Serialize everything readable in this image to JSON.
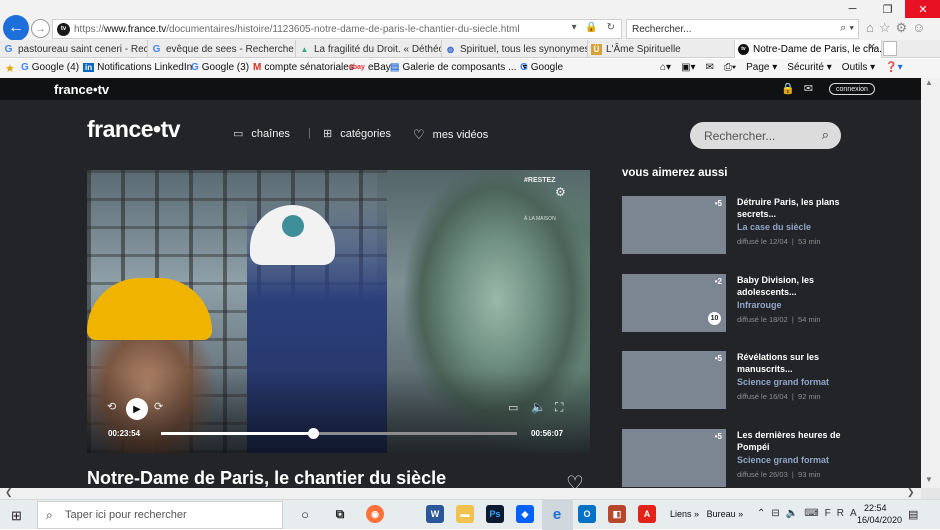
{
  "browser": {
    "url": {
      "protocol": "https://",
      "host": "www.france.tv",
      "path": "/documentaires/histoire/1123605-notre-dame-de-paris-le-chantier-du-siecle.html"
    },
    "search_placeholder": "Rechercher...",
    "tabs": [
      {
        "label": "pastoureau saint ceneri - Rech...",
        "icon": "google-icon"
      },
      {
        "label": "evêque de sees - Recherche Go...",
        "icon": "google-icon"
      },
      {
        "label": "La fragilité du Droit. « Déthéol...",
        "icon": "site-icon"
      },
      {
        "label": "Spirituel, tous les synonymes",
        "icon": "site-icon"
      },
      {
        "label": "L'Âme Spirituelle",
        "icon": "site-icon"
      },
      {
        "label": "Notre-Dame de Paris, le cha...",
        "icon": "francetv-icon",
        "active": true
      }
    ],
    "favorites": [
      {
        "label": "Google (4)",
        "icon": "G"
      },
      {
        "label": "Notifications LinkedIn",
        "icon": "in"
      },
      {
        "label": "Google (3)",
        "icon": "G"
      },
      {
        "label": "compte sénatoriales",
        "icon": "M"
      },
      {
        "label": "eBay",
        "icon": "ebay"
      },
      {
        "label": "Galerie de composants ...",
        "icon": "page"
      },
      {
        "label": "Google",
        "icon": "G"
      }
    ],
    "commands": {
      "page": "Page",
      "security": "Sécurité",
      "tools": "Outils"
    }
  },
  "site": {
    "strip_logo": "france•tv",
    "connexion": "connexion",
    "logo": "france•tv",
    "nav": {
      "channels": "chaînes",
      "categories": "catégories",
      "my_videos": "mes vidéos"
    },
    "search_placeholder": "Rechercher..."
  },
  "player": {
    "title": "Notre-Dame de Paris, le chantier du siècle",
    "current_time": "00:23:54",
    "total_time": "00:56:07",
    "progress": 0.426,
    "overlay_tag": "#RESTEZ",
    "overlay_sub": "À LA MAISON"
  },
  "suggestions": {
    "heading": "vous aimerez aussi",
    "items": [
      {
        "title": "Détruire Paris, les plans secrets...",
        "program": "La case du siècle",
        "date": "diffusé le 12/04",
        "duration": "53 min",
        "channel": "•5",
        "badge": ""
      },
      {
        "title": "Baby Division, les adolescents...",
        "program": "Infrarouge",
        "date": "diffusé le 18/02",
        "duration": "54 min",
        "channel": "•2",
        "badge": "10"
      },
      {
        "title": "Révélations sur les manuscrits...",
        "program": "Science grand format",
        "date": "diffusé le 16/04",
        "duration": "92 min",
        "channel": "•5",
        "badge": ""
      },
      {
        "title": "Les dernières heures de Pompéi",
        "program": "Science grand format",
        "date": "diffusé le 26/03",
        "duration": "93 min",
        "channel": "•5",
        "badge": ""
      }
    ]
  },
  "taskbar": {
    "search_placeholder": "Taper ici pour rechercher",
    "links": "Liens",
    "desktop": "Bureau",
    "lang": "FRA",
    "time": "22:54",
    "date": "16/04/2020"
  }
}
